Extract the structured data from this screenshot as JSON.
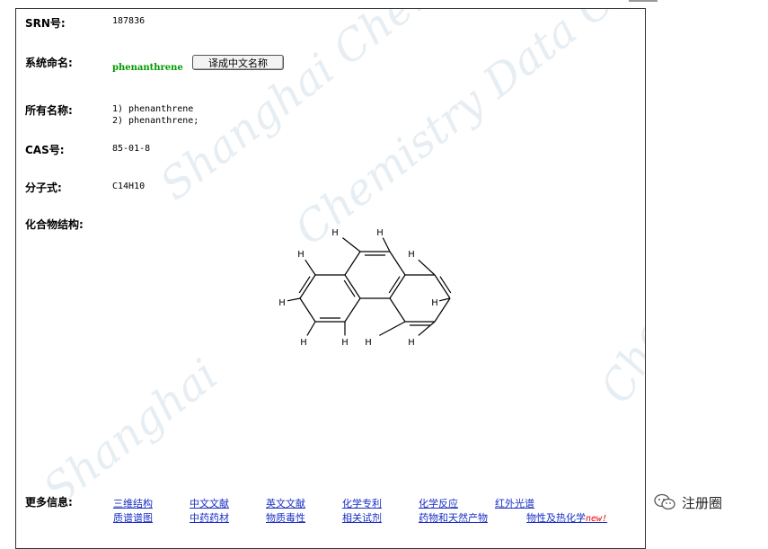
{
  "record": {
    "srn_label": "SRN号:",
    "srn_value": "187836",
    "sysname_label": "系统命名:",
    "sysname_value": "phenanthrene",
    "translate_button": "译成中文名称",
    "allnames_label": "所有名称:",
    "allnames": [
      "1) phenanthrene",
      "2) phenanthrene;"
    ],
    "cas_label": "CAS号:",
    "cas_value": "85-01-8",
    "formula_label": "分子式:",
    "formula_value": "C14H10",
    "structure_label": "化合物结构:",
    "atom_label": "H"
  },
  "more": {
    "label": "更多信息:",
    "row1": [
      "三维结构",
      "中文文献",
      "英文文献",
      "化学专利",
      "化学反应",
      "红外光谱"
    ],
    "row2": [
      "质谱谱图",
      "中药药材",
      "物质毒性",
      "相关试剂",
      "药物和天然产物",
      "物性及热化学"
    ],
    "new_badge": "new!"
  },
  "watermark": {
    "lines": [
      "Shanghai Chemistry &",
      "Chemistry Data Center",
      "Shanghai",
      "Chemistry &"
    ]
  },
  "footer": {
    "wechat_icon": "wechat-icon",
    "text": "注册圈"
  }
}
